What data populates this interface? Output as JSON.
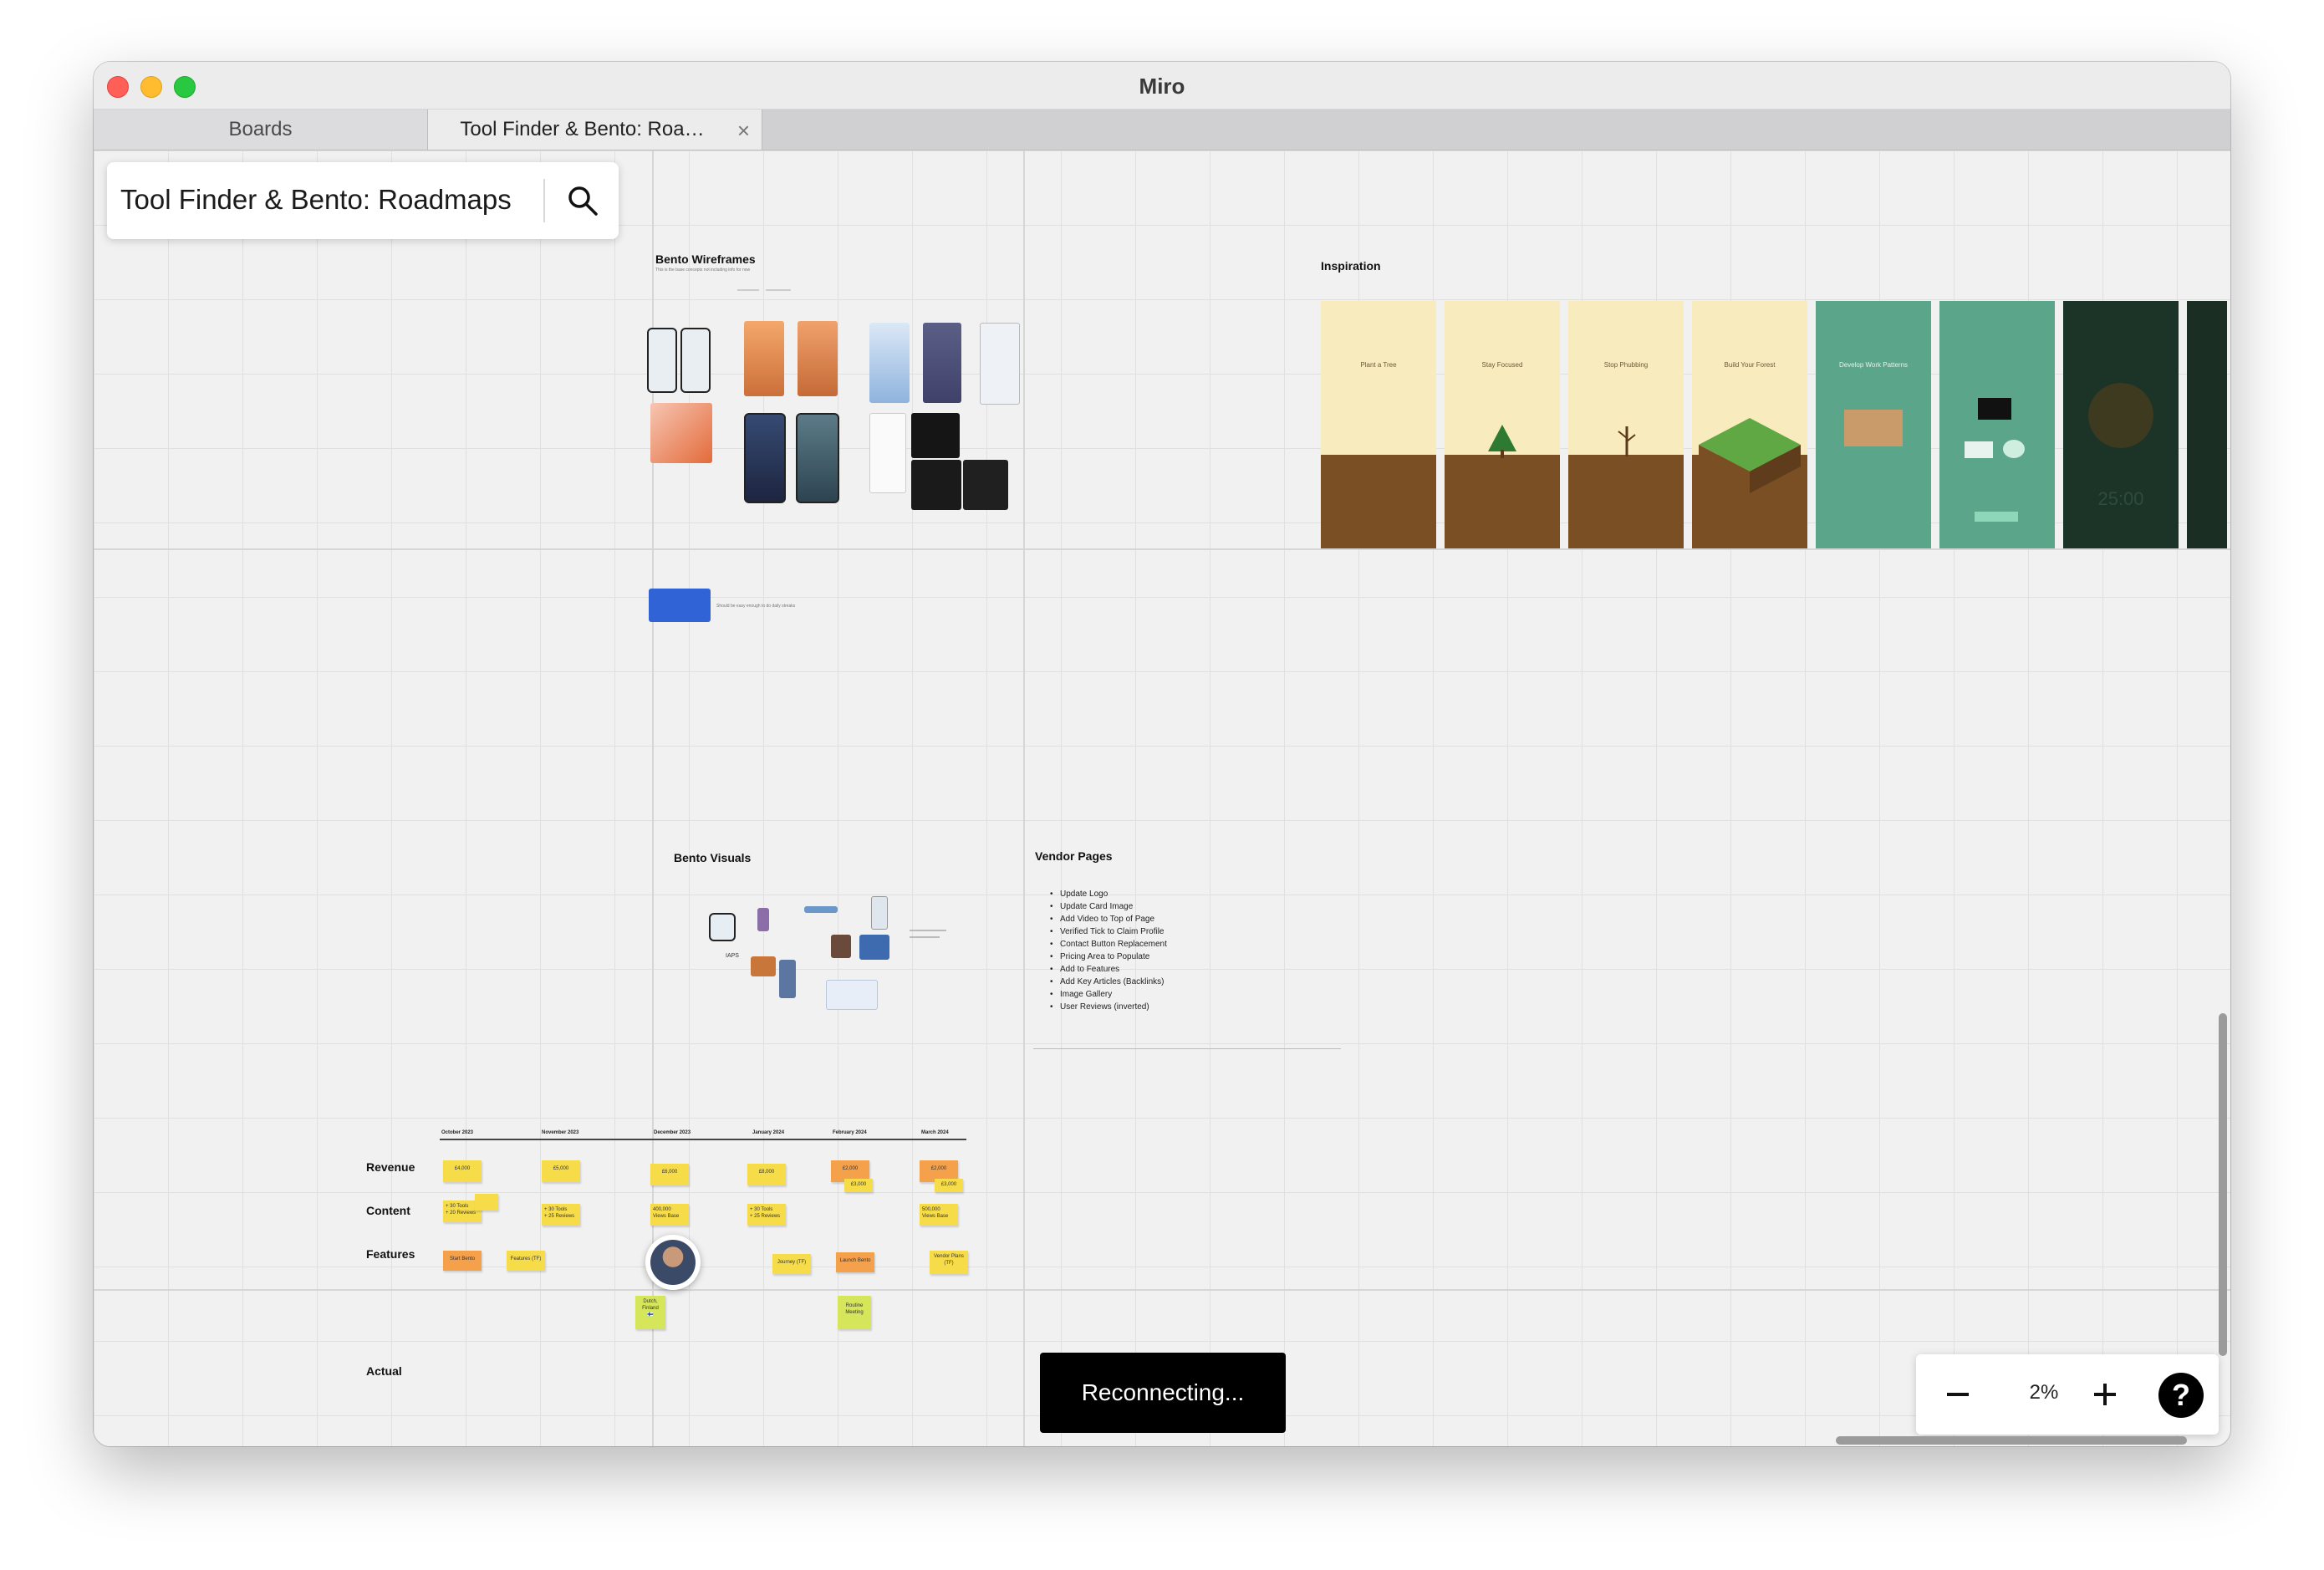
{
  "window": {
    "title": "Miro"
  },
  "tabs": [
    {
      "label": "Boards"
    },
    {
      "label": "Tool Finder & Bento: Roa…"
    }
  ],
  "board": {
    "title": "Tool Finder & Bento: Roadmaps"
  },
  "frames": {
    "bento_wireframes": {
      "title": "Bento Wireframes",
      "subtitle": "This is the base concepts not including info for now",
      "note": "Should be easy enough to do daily streaks"
    },
    "inspiration": {
      "title": "Inspiration",
      "screens": [
        {
          "heading": "Plant a Tree",
          "theme": "tan"
        },
        {
          "heading": "Stay Focused",
          "theme": "tan"
        },
        {
          "heading": "Stop Phubbing",
          "theme": "tan"
        },
        {
          "heading": "Build Your Forest",
          "theme": "tan"
        },
        {
          "heading": "Develop Work Patterns",
          "theme": "green"
        },
        {
          "heading": "",
          "theme": "green"
        },
        {
          "heading": "",
          "theme": "dark"
        },
        {
          "heading": "",
          "theme": "dark"
        }
      ],
      "timer": "25:00"
    },
    "bento_visuals": {
      "title": "Bento Visuals",
      "label": "IAPS"
    },
    "vendor_pages": {
      "title": "Vendor Pages",
      "items": [
        "Update Logo",
        "Update Card Image",
        "Add Video to Top of Page",
        "Verified Tick to Claim Profile",
        "Contact Button Replacement",
        "Pricing Area to Populate",
        "Add to Features",
        "Add Key Articles (Backlinks)",
        "Image Gallery",
        "User Reviews (inverted)"
      ]
    }
  },
  "roadmap": {
    "months": [
      "October 2023",
      "November 2023",
      "December 2023",
      "January 2024",
      "February 2024",
      "March 2024"
    ],
    "rows": {
      "revenue": "Revenue",
      "content": "Content",
      "features": "Features",
      "actual": "Actual"
    },
    "revenue": [
      "£4,000",
      "£5,000",
      "£6,000",
      "£8,000",
      "£2,000",
      "£2,000"
    ],
    "revenue_extra": [
      "£3,000",
      "£3,000"
    ],
    "content": [
      "+ 30 Tools\n+ 20 Reviews",
      "+ 30 Tools\n+ 25 Reviews",
      "400,000\nViews Base",
      "+ 30 Tools\n+ 25 Reviews",
      "500,000\nViews Base"
    ],
    "features": [
      "Start Bento",
      "Features (TF)",
      "Journey (TF)",
      "Launch Bento",
      "Vendor Plans\n(TF)"
    ],
    "extra_notes": [
      "Dutch,\nFinland\n🇫🇮",
      "Routine\nMeeting"
    ]
  },
  "status": {
    "toast": "Reconnecting..."
  },
  "zoom": {
    "value": "2%",
    "help": "?"
  }
}
